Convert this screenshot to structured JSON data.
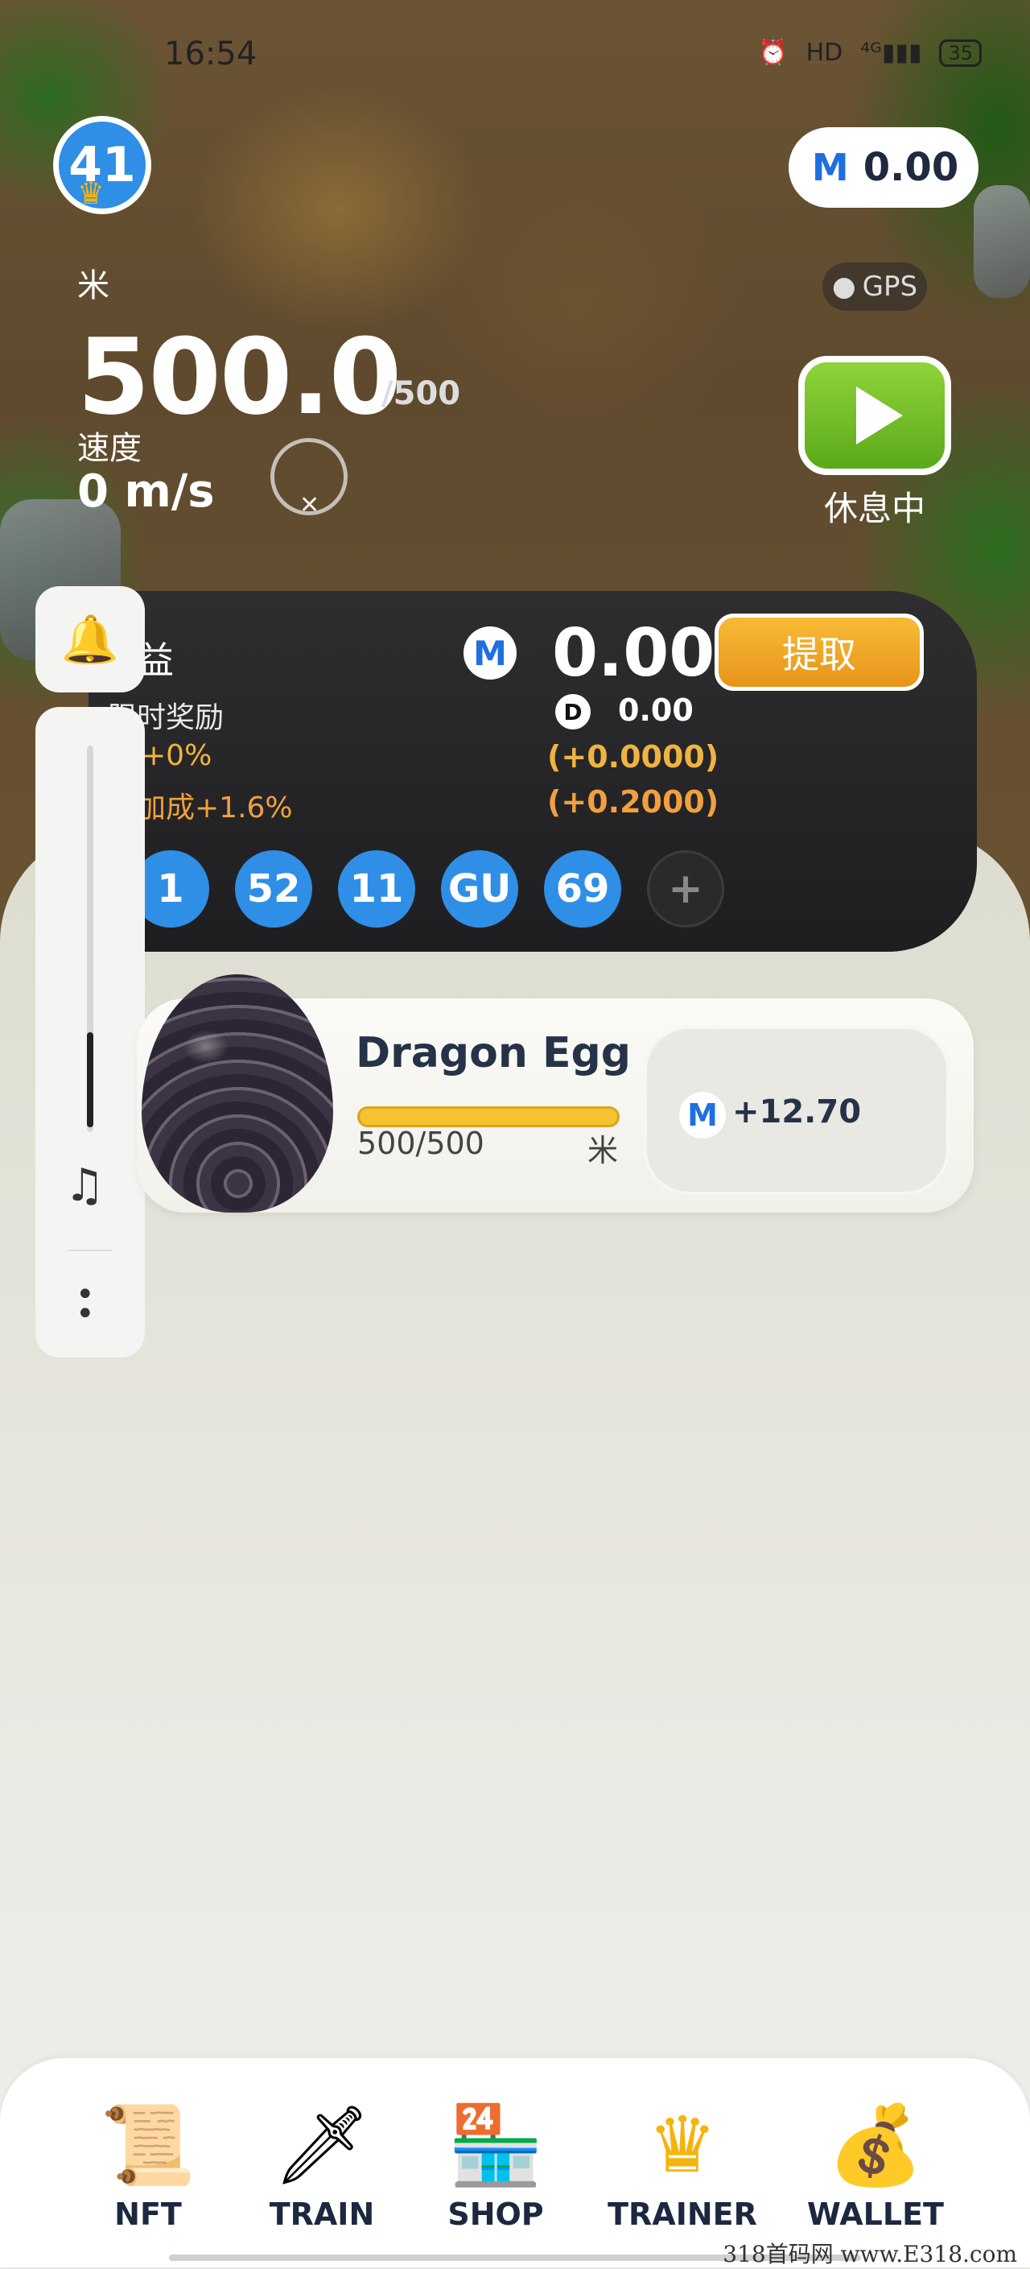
{
  "status_bar": {
    "time": "16:54",
    "network": "HD",
    "signal": "⁴ᴳ▮▮▮",
    "battery": "35"
  },
  "level": {
    "value": "41"
  },
  "balance": {
    "logo": "M",
    "value": "0.00"
  },
  "gps": {
    "label": "GPS"
  },
  "distance": {
    "unit": "米",
    "value": "500.0",
    "max": "/500"
  },
  "speed": {
    "label": "速度",
    "value": "0 m/s"
  },
  "rest": {
    "label": "休息中"
  },
  "earnings": {
    "title": "益",
    "subtitle": "限时奖励",
    "bonus1": "+0%",
    "bonus2": "队加成+1.6%",
    "total": "0.00",
    "d_logo": "D",
    "d_value": "0.00",
    "rate1": "(+0.0000)",
    "rate2": "(+0.2000)",
    "withdraw_label": "提取",
    "tokens": [
      "1",
      "52",
      "11",
      "GU",
      "69",
      "+"
    ]
  },
  "egg": {
    "name": "Dragon Egg",
    "progress_text": "500/500",
    "progress_fraction": 1.0,
    "unit": "米",
    "reward": "+12.70"
  },
  "nav": [
    {
      "label": "NFT",
      "icon": "scroll-icon"
    },
    {
      "label": "TRAIN",
      "icon": "sword-icon"
    },
    {
      "label": "SHOP",
      "icon": "shop-icon"
    },
    {
      "label": "TRAINER",
      "icon": "crown-icon"
    },
    {
      "label": "WALLET",
      "icon": "coin-bag-icon"
    }
  ],
  "watermark": "318首码网 www.E318.com",
  "colors": {
    "accent_blue": "#2f8ee6",
    "withdraw_orange": "#f0a020",
    "play_green": "#6cbf22"
  }
}
